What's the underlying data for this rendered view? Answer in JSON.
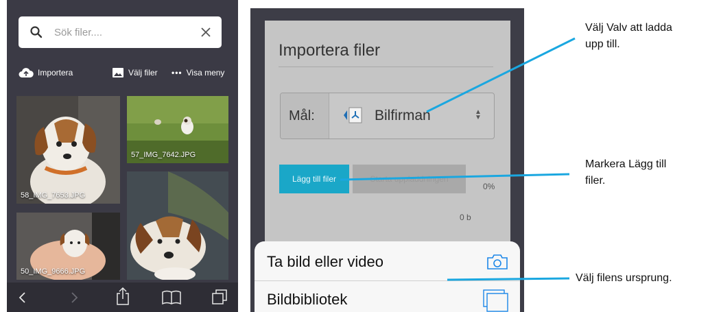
{
  "left_phone": {
    "search": {
      "placeholder": "Sök filer...."
    },
    "toolbar": {
      "import_label": "Importera",
      "choose_files_label": "Välj filer",
      "menu_label": "Visa meny"
    },
    "thumbnails": [
      {
        "filename": "58_IMG_7653.JPG"
      },
      {
        "filename": "57_IMG_7642.JPG"
      },
      {
        "filename": "50_IMG_9666.JPG"
      },
      {
        "filename": ""
      }
    ],
    "bottom_bar_icons": [
      "back-icon",
      "forward-icon",
      "share-icon",
      "bookmarks-icon",
      "tabs-icon"
    ]
  },
  "middle_phone": {
    "title": "Importera filer",
    "target": {
      "label": "Mål:",
      "value": "Bilfirman"
    },
    "buttons": {
      "add_files": "Lägg till filer",
      "start_upload": "Starta uppladdningen"
    },
    "progress": {
      "percent_text": "0%",
      "value": 0
    },
    "size_text": "0 b",
    "action_sheet": {
      "items": [
        {
          "label": "Ta bild eller video",
          "icon": "camera-icon"
        },
        {
          "label": "Bildbibliotek",
          "icon": "photo-library-icon"
        }
      ]
    }
  },
  "callouts": {
    "choose_vault": [
      "Välj Valv att ladda",
      "upp till."
    ],
    "mark_add_files": [
      "Markera Lägg till",
      "filer."
    ],
    "choose_source": "Välj filens ursprung."
  },
  "colors": {
    "accent": "#1aa7c8",
    "callout_line": "#1aa7e0",
    "dark_bg": "#3b3a45"
  }
}
